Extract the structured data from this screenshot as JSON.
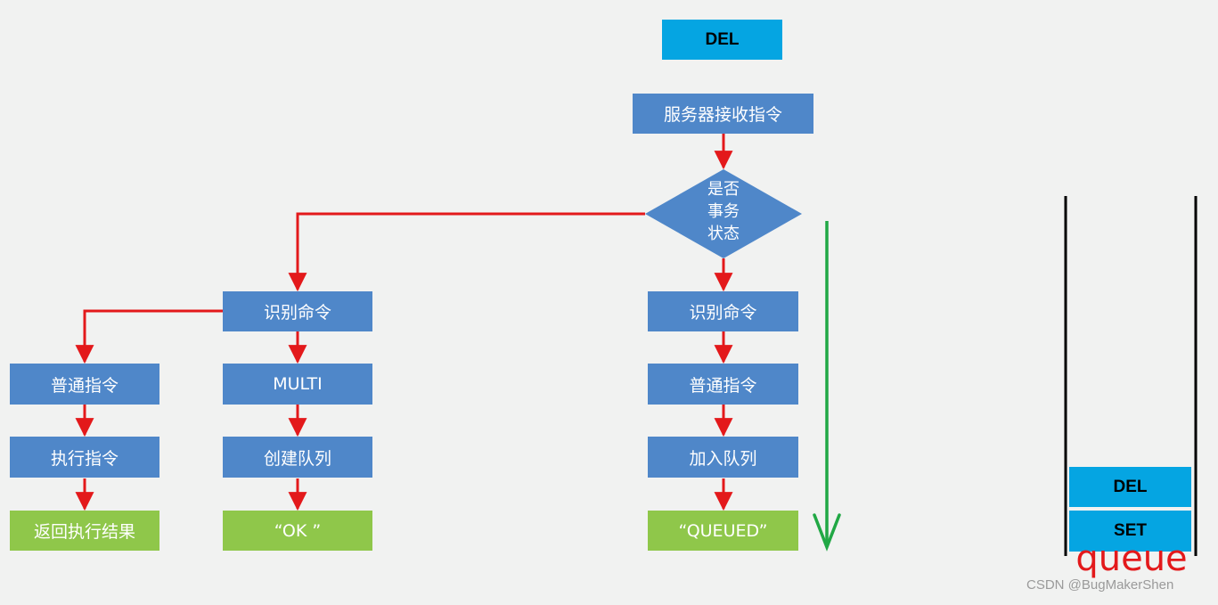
{
  "top_box": "DEL",
  "receive": "服务器接收指令",
  "decision": [
    "是否",
    "事务",
    "状态"
  ],
  "left": {
    "identify": "识别命令",
    "normal": "普通指令",
    "execute": "执行指令",
    "result": "返回执行结果",
    "multi": "MULTI",
    "create_queue": "创建队列",
    "ok": "“OK ”"
  },
  "right": {
    "identify": "识别命令",
    "normal": "普通指令",
    "enqueue": "加入队列",
    "queued": "“QUEUED”"
  },
  "queue": {
    "items": [
      "DEL",
      "SET"
    ],
    "label": "queue"
  },
  "watermark": "CSDN @BugMakerShen",
  "colors": {
    "process": "#4f87c9",
    "terminal": "#8fc74a",
    "command": "#05a5e2",
    "arrow": "#e3191b",
    "flow": "#21a845"
  }
}
